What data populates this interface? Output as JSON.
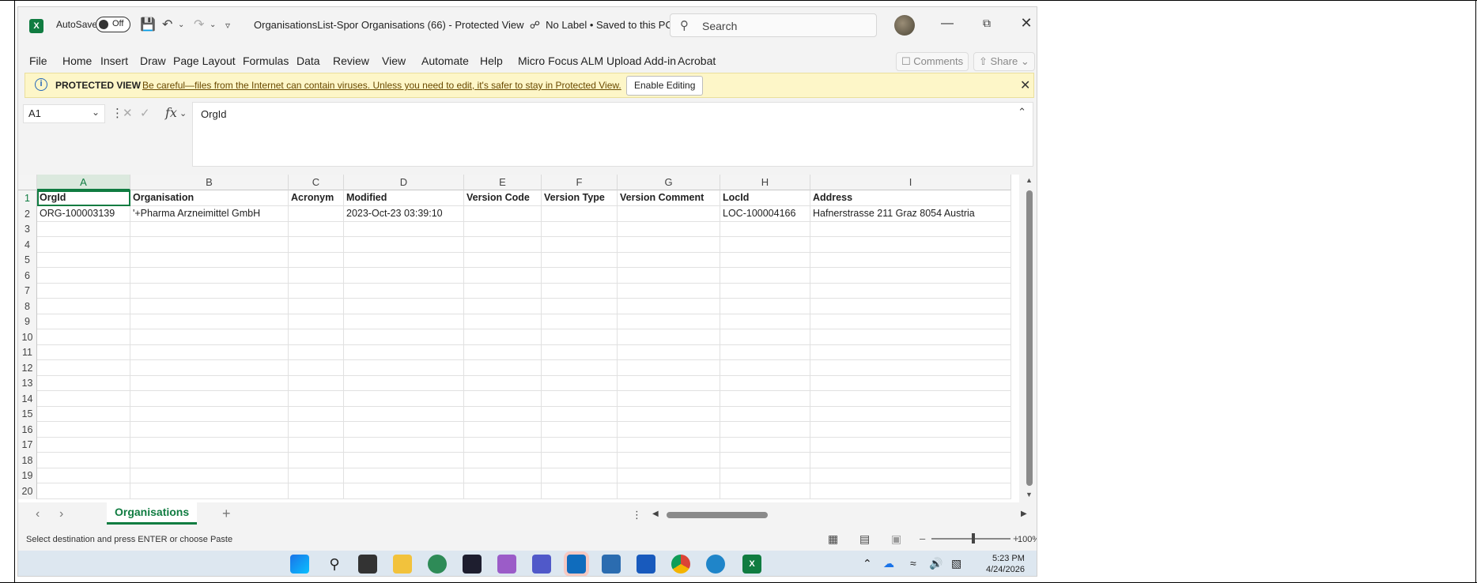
{
  "titlebar": {
    "autosave_label": "AutoSave",
    "autosave_state": "Off",
    "document_title": "OrganisationsList-Spor Organisations (66)  -  Protected View",
    "sensitivity": "No Label",
    "save_state": "Saved to this PC",
    "search_placeholder": "Search"
  },
  "menu": {
    "items": [
      "File",
      "Home",
      "Insert",
      "Draw",
      "Page Layout",
      "Formulas",
      "Data",
      "Review",
      "View",
      "Automate",
      "Help",
      "Micro Focus ALM Upload Add-in",
      "Acrobat"
    ],
    "comments_label": "Comments",
    "share_label": "Share"
  },
  "protected_view": {
    "title": "PROTECTED VIEW",
    "message": "Be careful—files from the Internet can contain viruses. Unless you need to edit, it's safer to stay in Protected View.",
    "button": "Enable Editing"
  },
  "formula_bar": {
    "name_box": "A1",
    "content": "OrgId"
  },
  "sheet": {
    "columns": [
      "A",
      "B",
      "C",
      "D",
      "E",
      "F",
      "G",
      "H",
      "I"
    ],
    "row_numbers": [
      "1",
      "2",
      "3",
      "4",
      "5",
      "6",
      "7",
      "8",
      "9",
      "10",
      "11",
      "12",
      "13",
      "14",
      "15",
      "16",
      "17",
      "18",
      "19",
      "20"
    ],
    "headers": [
      "OrgId",
      "Organisation",
      "Acronym",
      "Modified",
      "Version Code",
      "Version Type",
      "Version Comment",
      "LocId",
      "Address"
    ],
    "rows": [
      [
        "ORG-100003139",
        "'+Pharma Arzneimittel GmbH",
        "",
        "2023-Oct-23 03:39:10",
        "",
        "",
        "",
        "LOC-100004166",
        "Hafnerstrasse 211  Graz  8054 Austria"
      ]
    ],
    "selected_cell": "A1"
  },
  "tabs": {
    "active": "Organisations"
  },
  "status": {
    "message": "Select destination and press ENTER or choose Paste",
    "zoom": "100%"
  },
  "taskbar": {
    "time": "5:23 PM",
    "date": "4/24/2026"
  }
}
